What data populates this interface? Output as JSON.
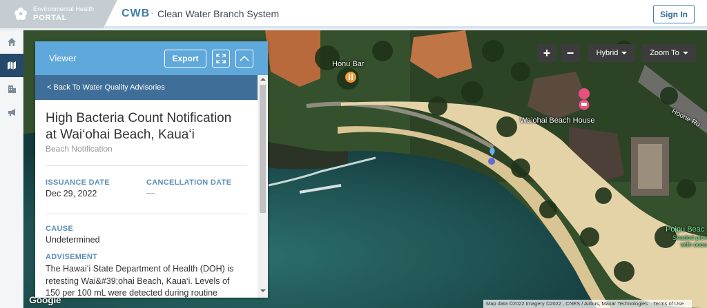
{
  "header": {
    "brand_line1": "Environmental Health",
    "brand_line2": "PORTAL",
    "app_abbr": "CWB",
    "app_name": "Clean Water Branch System",
    "signin_label": "Sign In"
  },
  "sidenav": {
    "items": [
      {
        "icon": "home-icon",
        "active": false
      },
      {
        "icon": "map-icon",
        "active": true
      },
      {
        "icon": "building-icon",
        "active": false
      },
      {
        "icon": "megaphone-icon",
        "active": false
      }
    ]
  },
  "map": {
    "controls": {
      "zoom_in": "+",
      "zoom_out": "−",
      "map_type": "Hybrid",
      "zoom_to": "Zoom To"
    },
    "labels": {
      "honu_bar": "Honu Bar",
      "waiohai_beach_house": "Waiohai Beach House",
      "hoone_road": "Hoone Ro",
      "poipu_beach": "Poipu Beac",
      "poipu_sub1": "Shaded picni",
      "poipu_sub2": "with ocea"
    },
    "google_logo": "Google",
    "attribution": {
      "map_data": "Map data ©2022 Imagery ©2022 , CNES / Airbus, Maxar Technologies",
      "terms": "Terms of Use"
    }
  },
  "viewer": {
    "title": "Viewer",
    "export_label": "Export",
    "back_link": "< Back To Water Quality Advisories",
    "notice_title": "High Bacteria Count Notification at Wai‘ohai Beach, Kaua‘i",
    "notice_type": "Beach Notification",
    "issuance_label": "ISSUANCE DATE",
    "issuance_value": "Dec 29, 2022",
    "cancellation_label": "CANCELLATION DATE",
    "cancellation_value": "—",
    "cause_label": "CAUSE",
    "cause_value": "Undetermined",
    "advisement_label": "ADVISEMENT",
    "advisement_text": "The Hawai‘i State Department of Health (DOH) is retesting Wai&#39;ohai Beach, Kaua‘i. Levels of 150 per 100 mL were detected during routine"
  }
}
